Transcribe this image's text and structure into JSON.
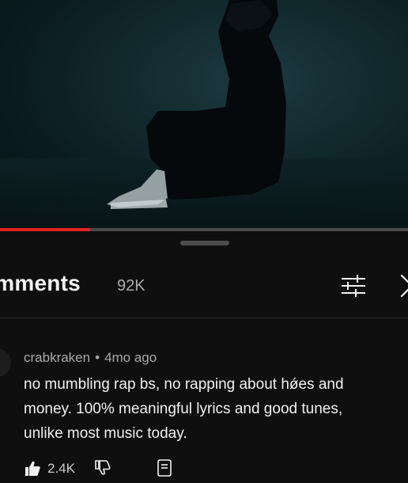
{
  "player": {
    "progress_fraction": 0.22,
    "colors": {
      "progress": "#e22222",
      "track": "#4a4a4a"
    }
  },
  "comments_panel": {
    "title": "omments",
    "count": "92K",
    "filter_icon": "sort-filter-icon",
    "close_icon": "close-icon"
  },
  "comment": {
    "author": "crabkraken",
    "separator": "•",
    "time": "4mo ago",
    "text_lines": [
      "no mumbling rap bs, no rapping about hǿes and",
      "money. 100% meaningful lyrics and good tunes,",
      "unlike most music today."
    ],
    "like_count": "2.4K",
    "icons": [
      "thumbs-up-icon",
      "thumbs-down-icon",
      "reply-icon"
    ]
  }
}
